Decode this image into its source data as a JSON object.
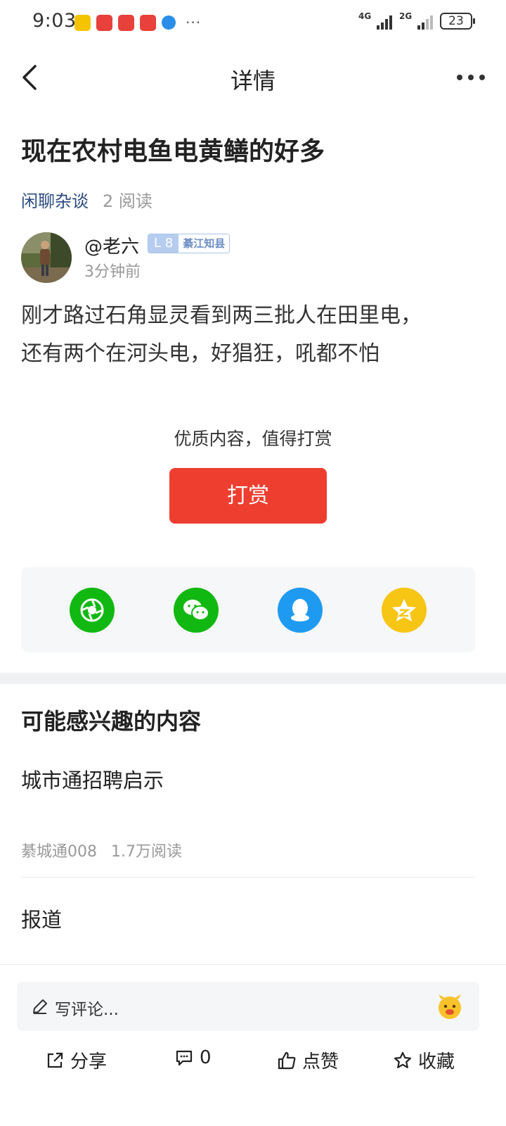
{
  "status_bar": {
    "time": "9:03",
    "more": "···",
    "net1": "4G",
    "net2": "2G",
    "battery": "23"
  },
  "nav": {
    "title": "详情"
  },
  "post": {
    "title": "现在农村电鱼电黄鳝的好多",
    "category": "闲聊杂谈",
    "reads": "2 阅读",
    "author": {
      "name": "@老六",
      "level": "L 8",
      "title": "綦江知县",
      "time": "3分钟前"
    },
    "body_line1": "刚才路过石角显灵看到两三批人在田里电，",
    "body_line2": "还有两个在河头电，好猖狂，吼都不怕"
  },
  "reward": {
    "hint": "优质内容，值得打赏",
    "button": "打赏"
  },
  "share_targets": [
    "moments-icon",
    "wechat-icon",
    "qq-icon",
    "qzone-icon"
  ],
  "colors": {
    "accent_red": "#ee3e30",
    "moments_green": "#12b812",
    "wechat_green": "#12b812",
    "qq_blue": "#1e9bf0",
    "qzone_yellow": "#f7c514"
  },
  "recommend": {
    "heading": "可能感兴趣的内容",
    "items": [
      {
        "title": "城市通招聘启示",
        "source": "綦城通008",
        "reads": "1.7万阅读"
      },
      {
        "title": "报道"
      }
    ]
  },
  "comment": {
    "placeholder": "写评论..."
  },
  "actions": {
    "share": "分享",
    "comments": "0",
    "like": "点赞",
    "favorite": "收藏"
  }
}
